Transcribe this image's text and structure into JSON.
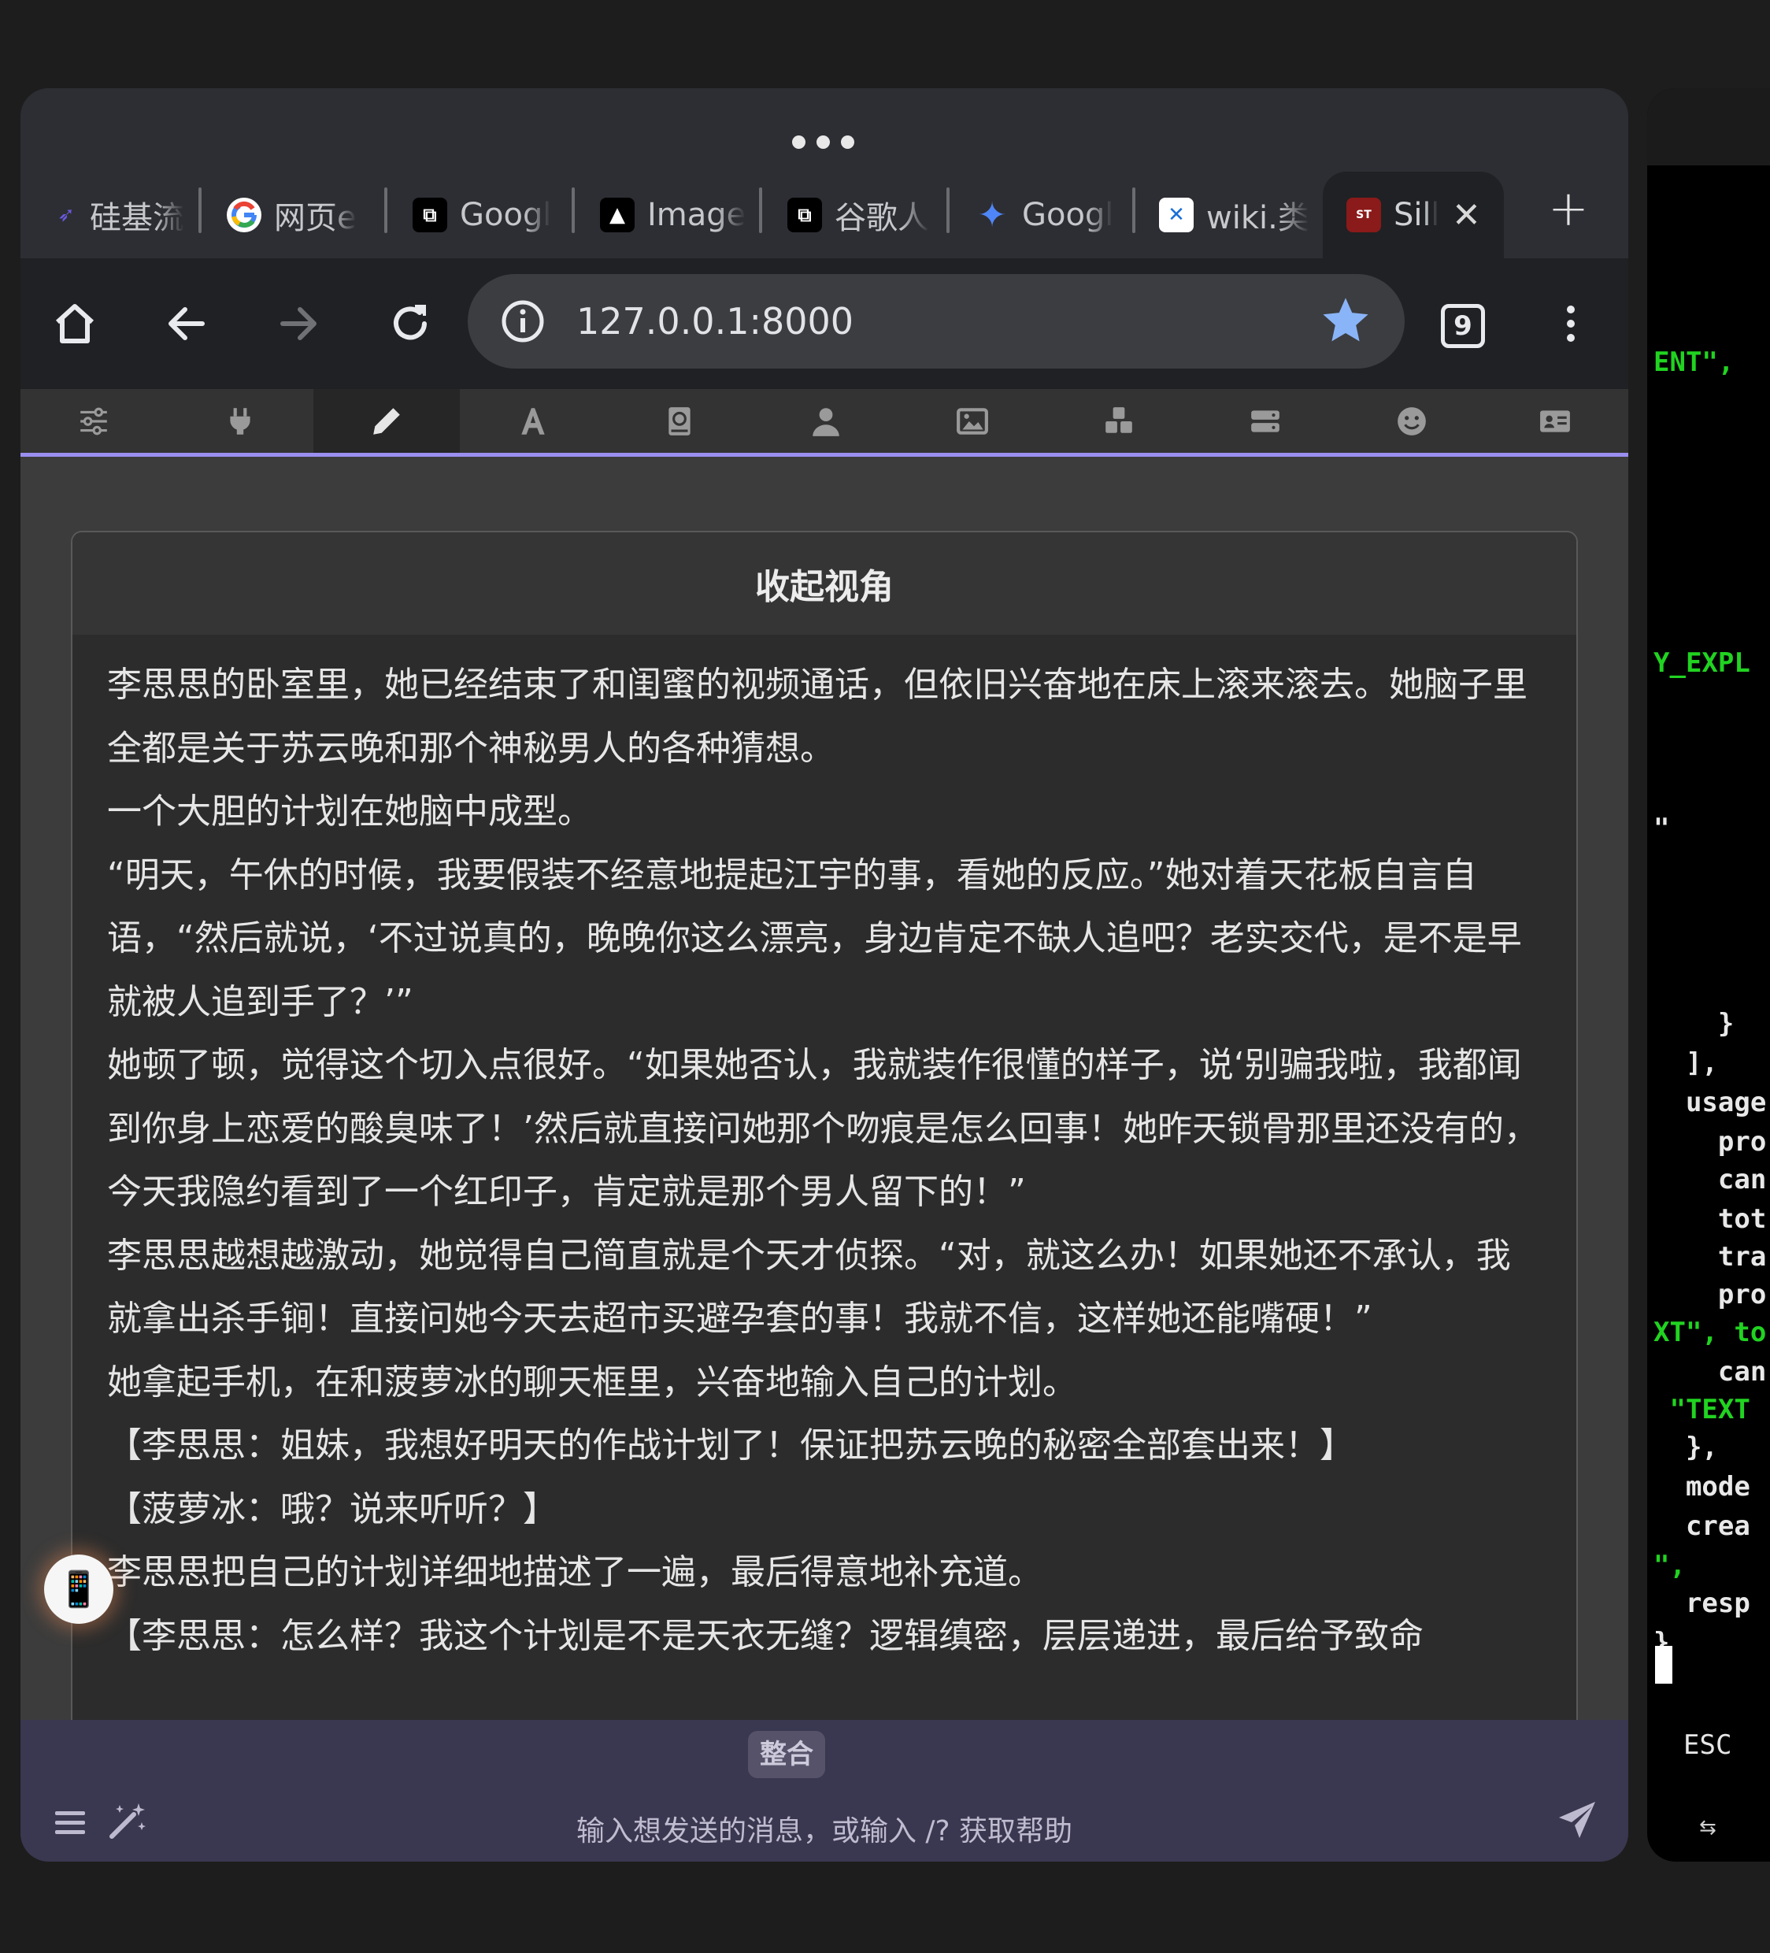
{
  "browser": {
    "tabs": [
      {
        "title": "硅基流",
        "icon": "siliconflow-icon",
        "color": "#6a5ae0"
      },
      {
        "title": "网页e",
        "icon": "google-g-icon",
        "color": "#ffffff"
      },
      {
        "title": "Googl",
        "icon": "app-icon",
        "color": "#000000"
      },
      {
        "title": "Image",
        "icon": "image-app-icon",
        "color": "#000000"
      },
      {
        "title": "谷歌人",
        "icon": "app-icon",
        "color": "#000000"
      },
      {
        "title": "Googl",
        "icon": "gemini-sparkle-icon",
        "color": "#4f86f7"
      },
      {
        "title": "wiki.类",
        "icon": "wiki-icon",
        "color": "#ffffff"
      },
      {
        "title": "Sill",
        "icon": "sillytavern-icon",
        "color": "#8b1a1a"
      }
    ],
    "active_tab_index": 7,
    "url": "127.0.0.1:8000",
    "tab_count": "9"
  },
  "app": {
    "nav_items": [
      "ai-response-config",
      "api-connections",
      "advanced-formatting",
      "user-settings-font",
      "world-info",
      "persona",
      "backgrounds",
      "extensions",
      "chat-server",
      "smiley",
      "character-management"
    ],
    "selected_nav_index": 2,
    "panel_title": "收起视角",
    "story": [
      "李思思的卧室里，她已经结束了和闺蜜的视频通话，但依旧兴奋地在床上滚来滚去。她脑子里全都是关于苏云晚和那个神秘男人的各种猜想。",
      "一个大胆的计划在她脑中成型。",
      "“明天，午休的时候，我要假装不经意地提起江宇的事，看她的反应。”她对着天花板自言自语，“然后就说，‘不过说真的，晚晚你这么漂亮，身边肯定不缺人追吧？老实交代，是不是早就被人追到手了？’”",
      "她顿了顿，觉得这个切入点很好。“如果她否认，我就装作很懂的样子，说‘别骗我啦，我都闻到你身上恋爱的酸臭味了！’然后就直接问她那个吻痕是怎么回事！她昨天锁骨那里还没有的，今天我隐约看到了一个红印子，肯定就是那个男人留下的！”",
      "李思思越想越激动，她觉得自己简直就是个天才侦探。“对，就这么办！如果她还不承认，我就拿出杀手锏！直接问她今天去超市买避孕套的事！我就不信，这样她还能嘴硬！”",
      "她拿起手机，在和菠萝冰的聊天框里，兴奋地输入自己的计划。",
      "【李思思：姐妹，我想好明天的作战计划了！保证把苏云晚的秘密全部套出来！】",
      "【菠萝冰：哦？说来听听？】",
      "李思思把自己的计划详细地描述了一遍，最后得意地补充道。",
      "【李思思：怎么样？我这个计划是不是天衣无缝？逻辑缜密，层层递进，最后给予致命"
    ],
    "floating_button": "📱",
    "bottom": {
      "merge_label": "整合",
      "input_placeholder": "输入想发送的消息，或输入 /? 获取帮助"
    }
  },
  "terminal": {
    "lines": [
      {
        "text": "ENT\",",
        "color": "green"
      },
      {
        "text": "Y_EXPL",
        "color": "green"
      },
      {
        "text": "\"",
        "color": "white"
      },
      {
        "text": "    }",
        "color": "white"
      },
      {
        "text": "  ],",
        "color": "white"
      },
      {
        "text": "  usage",
        "color": "white"
      },
      {
        "text": "    pro",
        "color": "white"
      },
      {
        "text": "    can",
        "color": "white"
      },
      {
        "text": "    tot",
        "color": "white"
      },
      {
        "text": "    tra",
        "color": "white"
      },
      {
        "text": "    pro",
        "color": "white"
      },
      {
        "text": "XT\", to",
        "color": "green"
      },
      {
        "text": "    can",
        "color": "white"
      },
      {
        "text": " \"TEXT",
        "color": "green"
      },
      {
        "text": "  },",
        "color": "white"
      },
      {
        "text": "  mode",
        "color": "white"
      },
      {
        "text": "  crea",
        "color": "white"
      },
      {
        "text": "\",",
        "color": "green"
      },
      {
        "text": "  resp",
        "color": "white"
      },
      {
        "text": "}",
        "color": "white"
      }
    ],
    "esc_label": "ESC",
    "tab_key_label": "⇆"
  }
}
